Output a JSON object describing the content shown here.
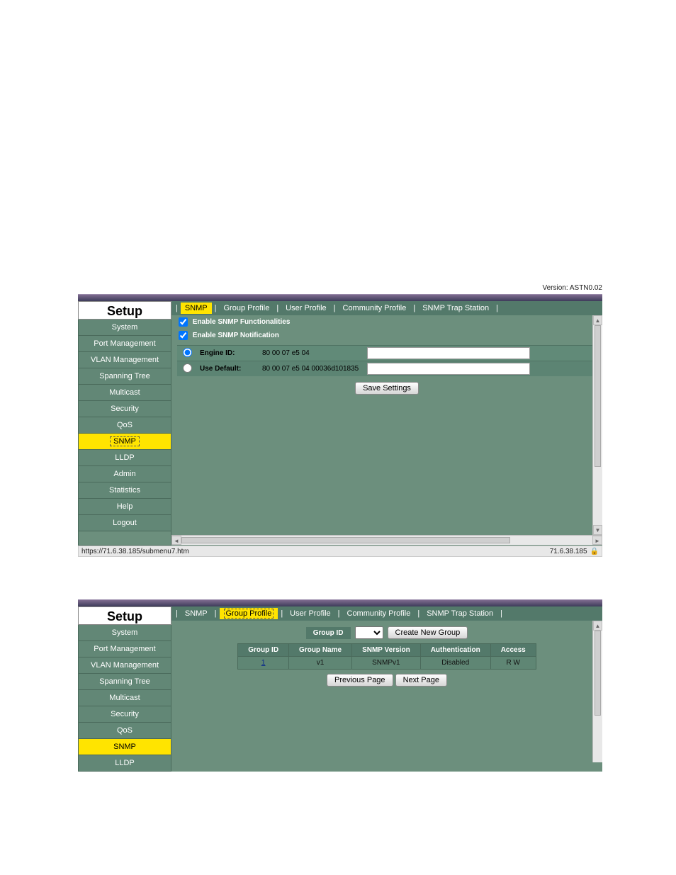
{
  "version_label": "Version: ASTN0.02",
  "setup_heading": "Setup",
  "menu": [
    "System",
    "Port Management",
    "VLAN Management",
    "Spanning Tree",
    "Multicast",
    "Security",
    "QoS",
    "SNMP",
    "LLDP",
    "Admin",
    "Statistics",
    "Help",
    "Logout"
  ],
  "block1": {
    "tabs": [
      "SNMP",
      "Group Profile",
      "User Profile",
      "Community Profile",
      "SNMP Trap Station"
    ],
    "active_tab": "SNMP",
    "checkbox1": "Enable SNMP Functionalities",
    "checkbox2": "Enable SNMP Notification",
    "engine_id_label": "Engine ID:",
    "engine_id_value": "80 00 07 e5 04",
    "use_default_label": "Use Default:",
    "use_default_value": "80 00 07 e5 04 00036d101835",
    "save_button": "Save Settings",
    "status_left": "https://71.6.38.185/submenu7.htm",
    "status_right": "71.6.38.185"
  },
  "block2": {
    "tabs": [
      "SNMP",
      "Group Profile",
      "User Profile",
      "Community Profile",
      "SNMP Trap Station"
    ],
    "active_tab": "Group Profile",
    "menu_visible": [
      "System",
      "Port Management",
      "VLAN Management",
      "Spanning Tree",
      "Multicast",
      "Security",
      "QoS",
      "SNMP",
      "LLDP"
    ],
    "group_id_label": "Group ID",
    "create_button": "Create New Group",
    "table": {
      "headers": [
        "Group ID",
        "Group Name",
        "SNMP Version",
        "Authentication",
        "Access"
      ],
      "rows": [
        {
          "id": "1",
          "name": "v1",
          "version": "SNMPv1",
          "auth": "Disabled",
          "access": "R W"
        }
      ]
    },
    "prev_button": "Previous Page",
    "next_button": "Next Page"
  }
}
